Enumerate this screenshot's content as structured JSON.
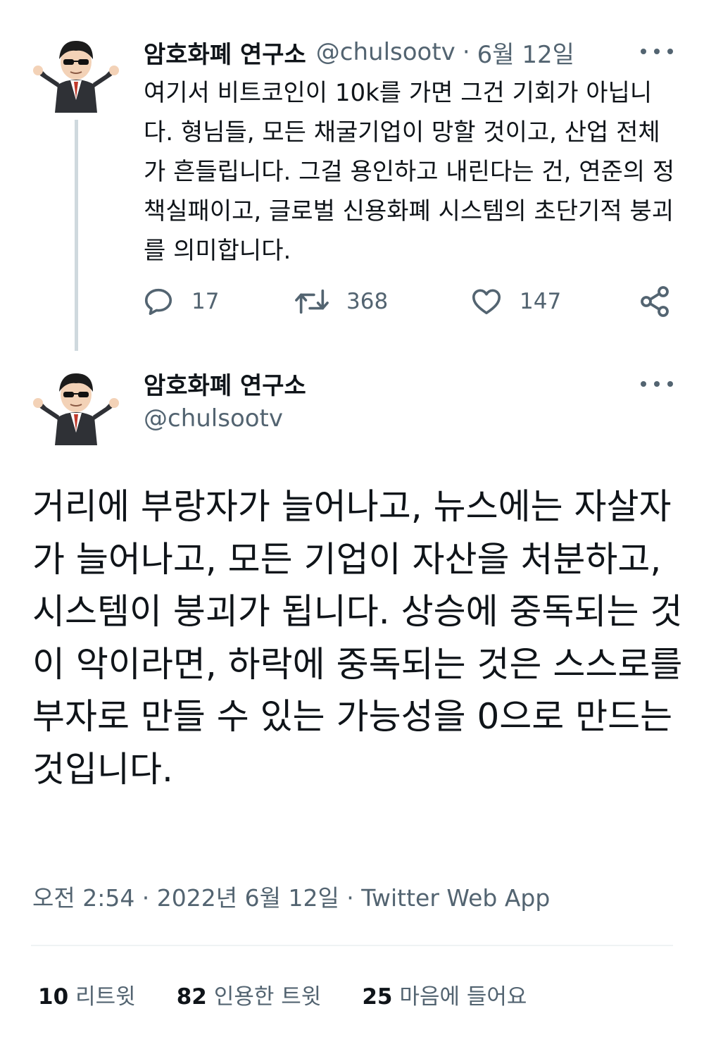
{
  "thread_parent": {
    "author_name": "암호화폐 연구소",
    "handle": "@chulsootv",
    "separator": "·",
    "date": "6월 12일",
    "body": "여기서 비트코인이 10k를 가면 그건 기회가 아닙니다. 형님들, 모든 채굴기업이 망할 것이고, 산업 전체가 흔들립니다. 그걸 용인하고 내린다는 건, 연준의 정책실패이고, 글로벌 신용화폐 시스템의 초단기적 붕괴를 의미합니다.",
    "replies": "17",
    "retweets": "368",
    "likes": "147",
    "icons": [
      "more-icon",
      "reply-icon",
      "retweet-icon",
      "like-icon",
      "share-icon"
    ]
  },
  "main_tweet": {
    "author_name": "암호화폐 연구소",
    "handle": "@chulsootv",
    "body": "거리에 부랑자가 늘어나고, 뉴스에는 자살자가 늘어나고, 모든 기업이 자산을 처분하고, 시스템이 붕괴가 됩니다. 상승에 중독되는 것이 악이라면, 하락에 중독되는 것은 스스로를 부자로 만들 수 있는 가능성을 0으로 만드는 것입니다.",
    "timestamp": "오전 2:54 · 2022년 6월 12일 · ",
    "source": "Twitter Web App"
  },
  "stats": {
    "retweets_count": "10",
    "retweets_label": "리트윗",
    "quotes_count": "82",
    "quotes_label": "인용한 트윗",
    "likes_count": "25",
    "likes_label": "마음에 들어요"
  },
  "colors": {
    "text_primary": "#0f1419",
    "text_secondary": "#536471",
    "thread_line": "#cfd9de",
    "divider": "#eff3f4"
  }
}
